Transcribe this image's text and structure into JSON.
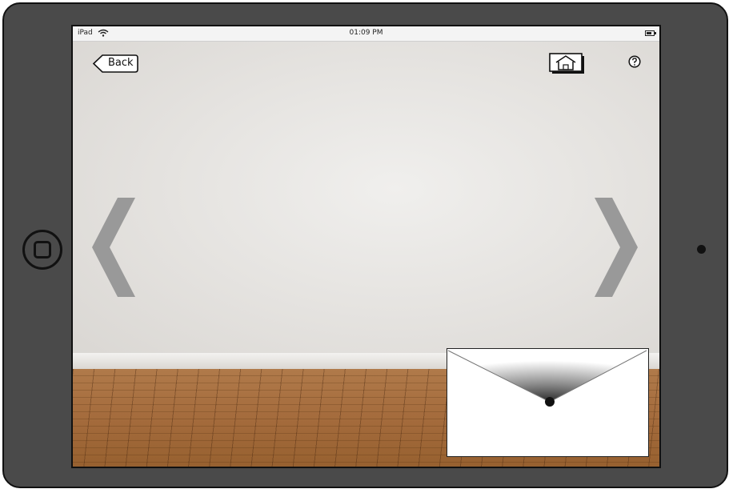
{
  "status_bar": {
    "carrier": "iPad",
    "time": "01:09 PM",
    "wifi_icon": "wifi-icon",
    "battery_icon": "battery-icon"
  },
  "nav": {
    "back_label": "Back",
    "home_icon": "house-icon",
    "help_icon": "question-mark-icon"
  },
  "arrows": {
    "left_icon": "chevron-left-icon",
    "right_icon": "chevron-right-icon"
  },
  "colors": {
    "device_frame": "#4a4a4a",
    "arrow": "#999999",
    "wall": "#e6e4e1",
    "floor": "#a46b3c"
  }
}
